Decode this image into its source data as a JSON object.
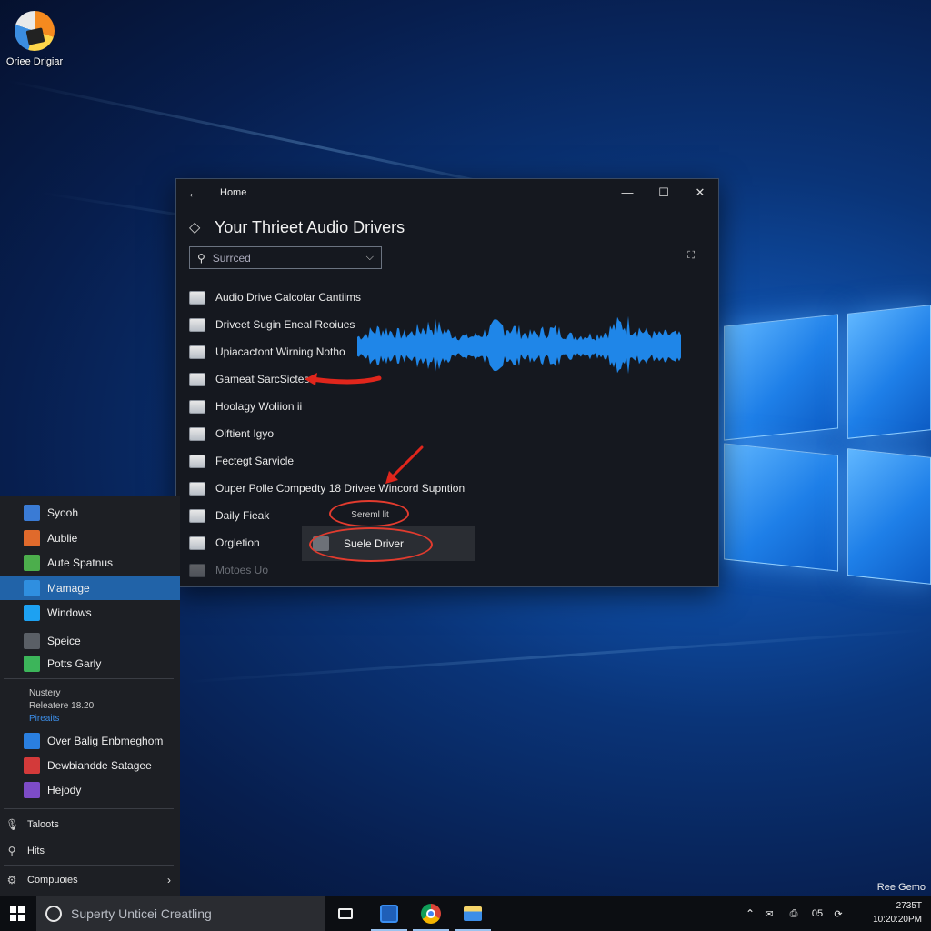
{
  "desktop": {
    "icon_label": "Oriee Drigiar",
    "corner_text": "Ree Gemo"
  },
  "window": {
    "title": "Home",
    "heading": "Your Thrieet Audio Drivers",
    "search": {
      "value": "Surrced"
    },
    "items": [
      {
        "label": "Audio Drive Calcofar Cantiims"
      },
      {
        "label": "Driveet Sugin Eneal Reoiues"
      },
      {
        "label": "Upiacactont Wirning Notho"
      },
      {
        "label": "Gameat SarcSictes"
      },
      {
        "label": "Hoolagy Woliion ii"
      },
      {
        "label": "Oiftient Igyo"
      },
      {
        "label": "Fectegt Sarvicle"
      },
      {
        "label": "Ouper Polle Compedty 18 Drivee Wincord Supntion"
      },
      {
        "label": "Daily Fieak"
      },
      {
        "label": "Orgletion"
      },
      {
        "label": "Motoes Uo"
      }
    ],
    "popup_label": "Sereml lit",
    "popup_action": "Suele Driver"
  },
  "start_menu": {
    "apps": [
      {
        "label": "Syooh",
        "color": "#3a7bd5"
      },
      {
        "label": "Aublie",
        "color": "#e06a2c"
      },
      {
        "label": "Aute Spatnus",
        "color": "#4cae4c"
      },
      {
        "label": "Mamage",
        "color": "#2f8fe0"
      },
      {
        "label": "Windows",
        "color": "#1da1f2"
      },
      {
        "label": "Speice",
        "color": "#5a5f66"
      },
      {
        "label": "Potts Garly",
        "color": "#3cb55a"
      }
    ],
    "recent_title": "Nustery",
    "recent_sub": "Releatere 18.20.",
    "recent_link": "Pireaits",
    "recent_apps": [
      {
        "label": "Over Balig Enbmeghom",
        "color": "#2a7fe0"
      },
      {
        "label": "Dewbiandde Satagee",
        "color": "#d33a3a"
      },
      {
        "label": "Hejody",
        "color": "#7d4cc7"
      }
    ],
    "system": [
      {
        "label": "Taloots"
      },
      {
        "label": "Hits"
      },
      {
        "label": "Compuoies"
      }
    ]
  },
  "taskbar": {
    "search_placeholder": "Superty Unticei Creatling",
    "tray_number": "05",
    "clock_time": "2735T",
    "clock_date": "10:20:20PM"
  }
}
